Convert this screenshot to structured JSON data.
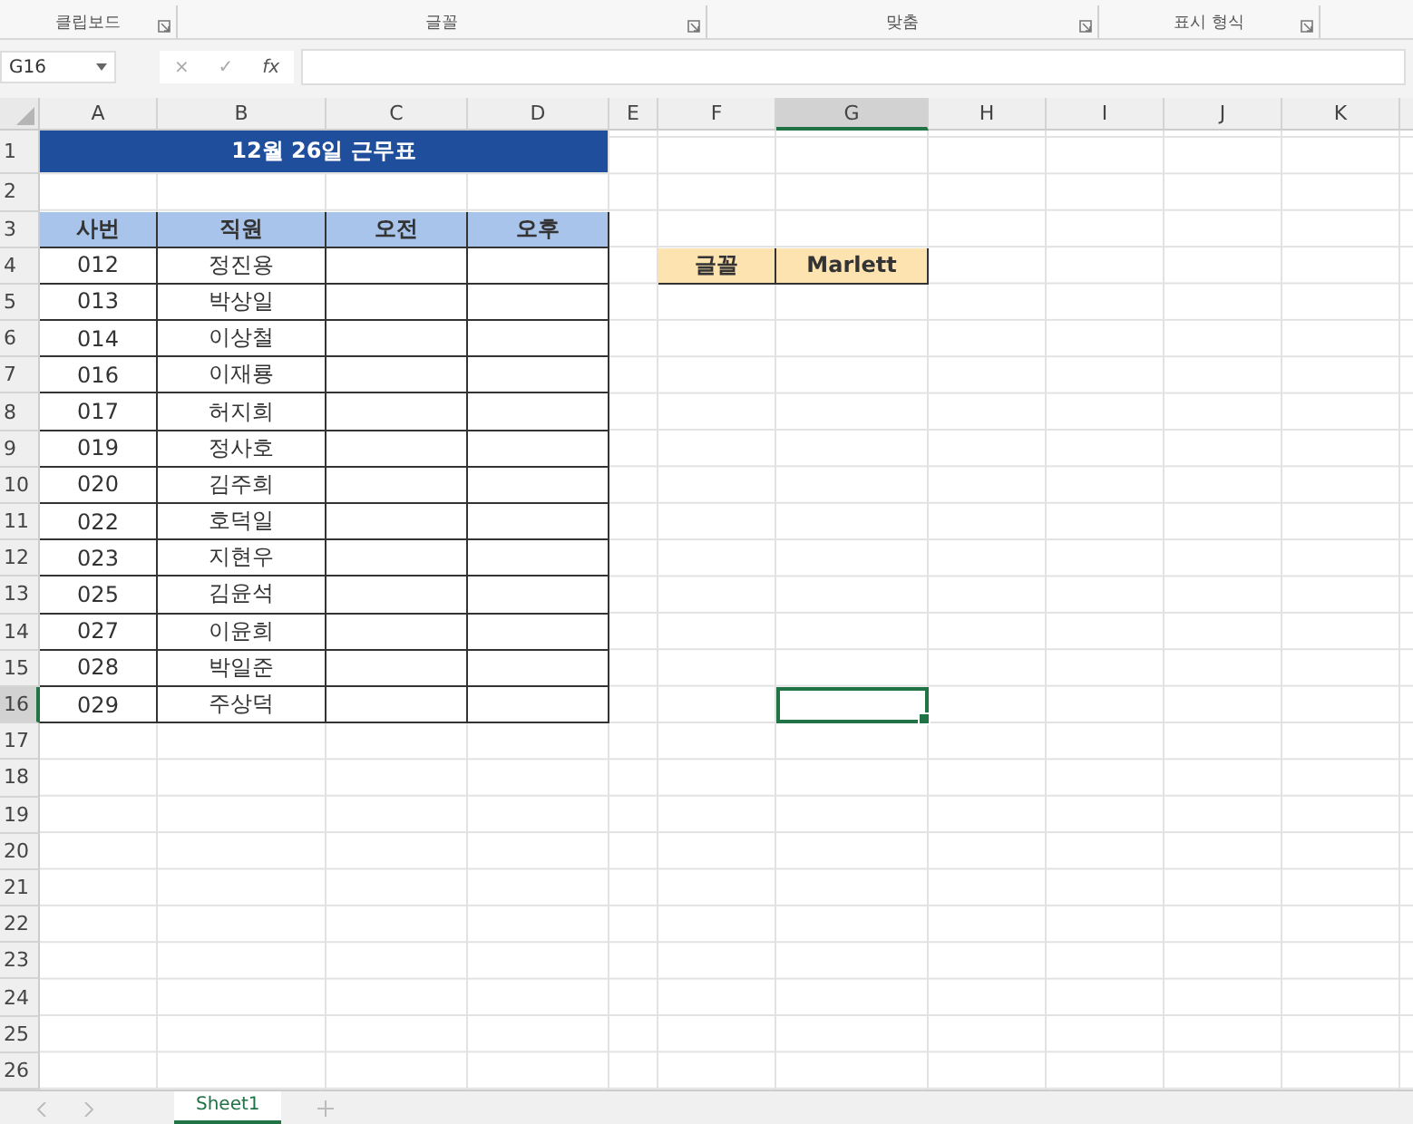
{
  "ribbon": {
    "groups": [
      "클립보드",
      "글꼴",
      "맞춤",
      "표시 형식"
    ]
  },
  "formula_bar": {
    "name_box": "G16",
    "cancel": "×",
    "enter": "✓",
    "fx": "fx"
  },
  "columns": [
    {
      "label": "A",
      "selected": false
    },
    {
      "label": "B",
      "selected": false
    },
    {
      "label": "C",
      "selected": false
    },
    {
      "label": "D",
      "selected": false
    },
    {
      "label": "E",
      "selected": false
    },
    {
      "label": "F",
      "selected": false
    },
    {
      "label": "G",
      "selected": true
    },
    {
      "label": "H",
      "selected": false
    },
    {
      "label": "I",
      "selected": false
    },
    {
      "label": "J",
      "selected": false
    },
    {
      "label": "K",
      "selected": false
    }
  ],
  "rows": [
    {
      "label": "1",
      "selected": false
    },
    {
      "label": "2",
      "selected": false
    },
    {
      "label": "3",
      "selected": false
    },
    {
      "label": "4",
      "selected": false
    },
    {
      "label": "5",
      "selected": false
    },
    {
      "label": "6",
      "selected": false
    },
    {
      "label": "7",
      "selected": false
    },
    {
      "label": "8",
      "selected": false
    },
    {
      "label": "9",
      "selected": false
    },
    {
      "label": "10",
      "selected": false
    },
    {
      "label": "11",
      "selected": false
    },
    {
      "label": "12",
      "selected": false
    },
    {
      "label": "13",
      "selected": false
    },
    {
      "label": "14",
      "selected": false
    },
    {
      "label": "15",
      "selected": false
    },
    {
      "label": "16",
      "selected": true
    },
    {
      "label": "17",
      "selected": false
    },
    {
      "label": "18",
      "selected": false
    },
    {
      "label": "19",
      "selected": false
    },
    {
      "label": "20",
      "selected": false
    },
    {
      "label": "21",
      "selected": false
    },
    {
      "label": "22",
      "selected": false
    },
    {
      "label": "23",
      "selected": false
    },
    {
      "label": "24",
      "selected": false
    },
    {
      "label": "25",
      "selected": false
    },
    {
      "label": "26",
      "selected": false
    }
  ],
  "table": {
    "title": "12월 26일 근무표",
    "headers": [
      "사번",
      "직원",
      "오전",
      "오후"
    ],
    "rows": [
      {
        "id": "012",
        "name": "정진용"
      },
      {
        "id": "013",
        "name": "박상일"
      },
      {
        "id": "014",
        "name": "이상철"
      },
      {
        "id": "016",
        "name": "이재룡"
      },
      {
        "id": "017",
        "name": "허지희"
      },
      {
        "id": "019",
        "name": "정사호"
      },
      {
        "id": "020",
        "name": "김주희"
      },
      {
        "id": "022",
        "name": "호덕일"
      },
      {
        "id": "023",
        "name": "지현우"
      },
      {
        "id": "025",
        "name": "김윤석"
      },
      {
        "id": "027",
        "name": "이윤희"
      },
      {
        "id": "028",
        "name": "박일준"
      },
      {
        "id": "029",
        "name": "주상덕"
      }
    ]
  },
  "font_box": {
    "label": "글꼴",
    "value": "Marlett"
  },
  "sheet_tabs": [
    {
      "label": "Sheet1",
      "selected": true
    }
  ]
}
